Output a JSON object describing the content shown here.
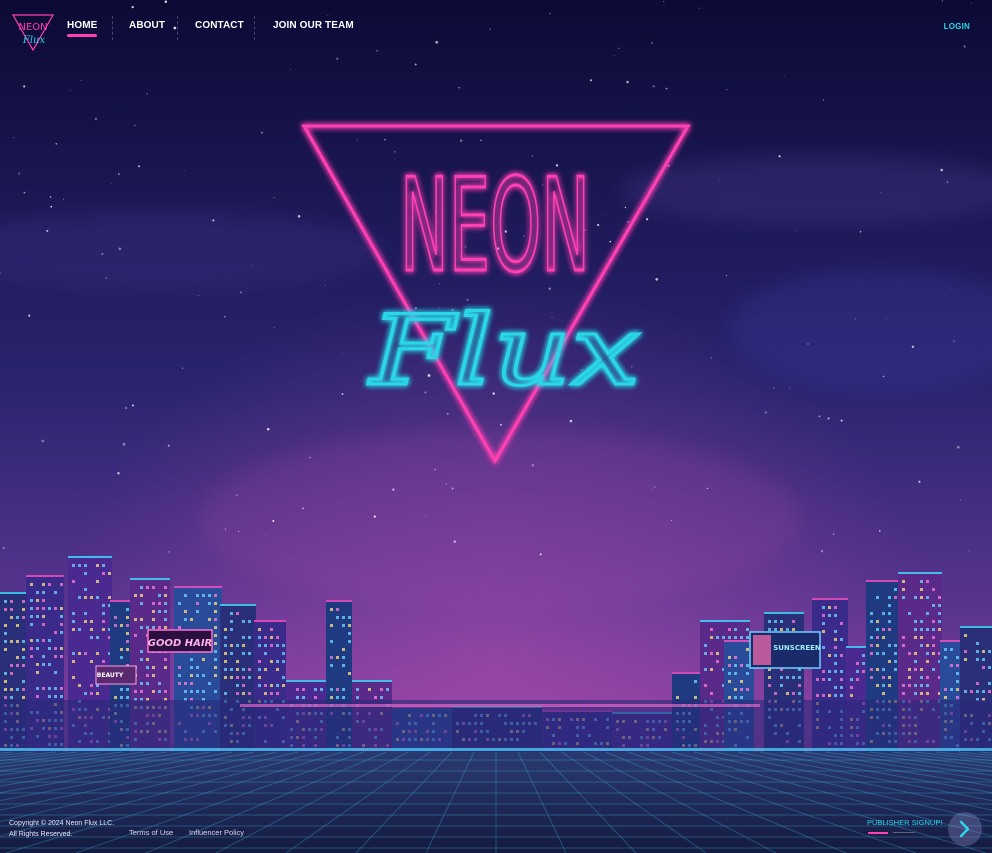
{
  "brand": {
    "logo_words": [
      "NEON",
      "Flux"
    ],
    "colors": {
      "pink": "#ff3fb2",
      "cyan": "#2ad6e8",
      "sky_top": "#0c0a35",
      "sky_mid": "#3a2a78",
      "horizon": "#7a3a9a"
    }
  },
  "nav": {
    "items": [
      {
        "label": "HOME",
        "active": true
      },
      {
        "label": "ABOUT",
        "active": false
      },
      {
        "label": "CONTACT",
        "active": false
      },
      {
        "label": "JOIN OUR TEAM",
        "active": false
      }
    ],
    "login_label": "LOGIN"
  },
  "hero": {
    "title_line1": "NEON",
    "title_line2": "Flux"
  },
  "billboards": {
    "good_hair": "GOOD HAIR",
    "beauty": "BEAUTY",
    "sunscreen": "SUNSCREEN"
  },
  "footer": {
    "copyright": "Copyright © 2024 Neon Flux LLC.",
    "rights": "All Rights Reserved.",
    "terms_label": "Terms of Use",
    "influencer_label": "Influencer Policy",
    "publisher_label": "PUBLISHER SIGNUP!",
    "next_icon": "chevron-right-icon"
  }
}
